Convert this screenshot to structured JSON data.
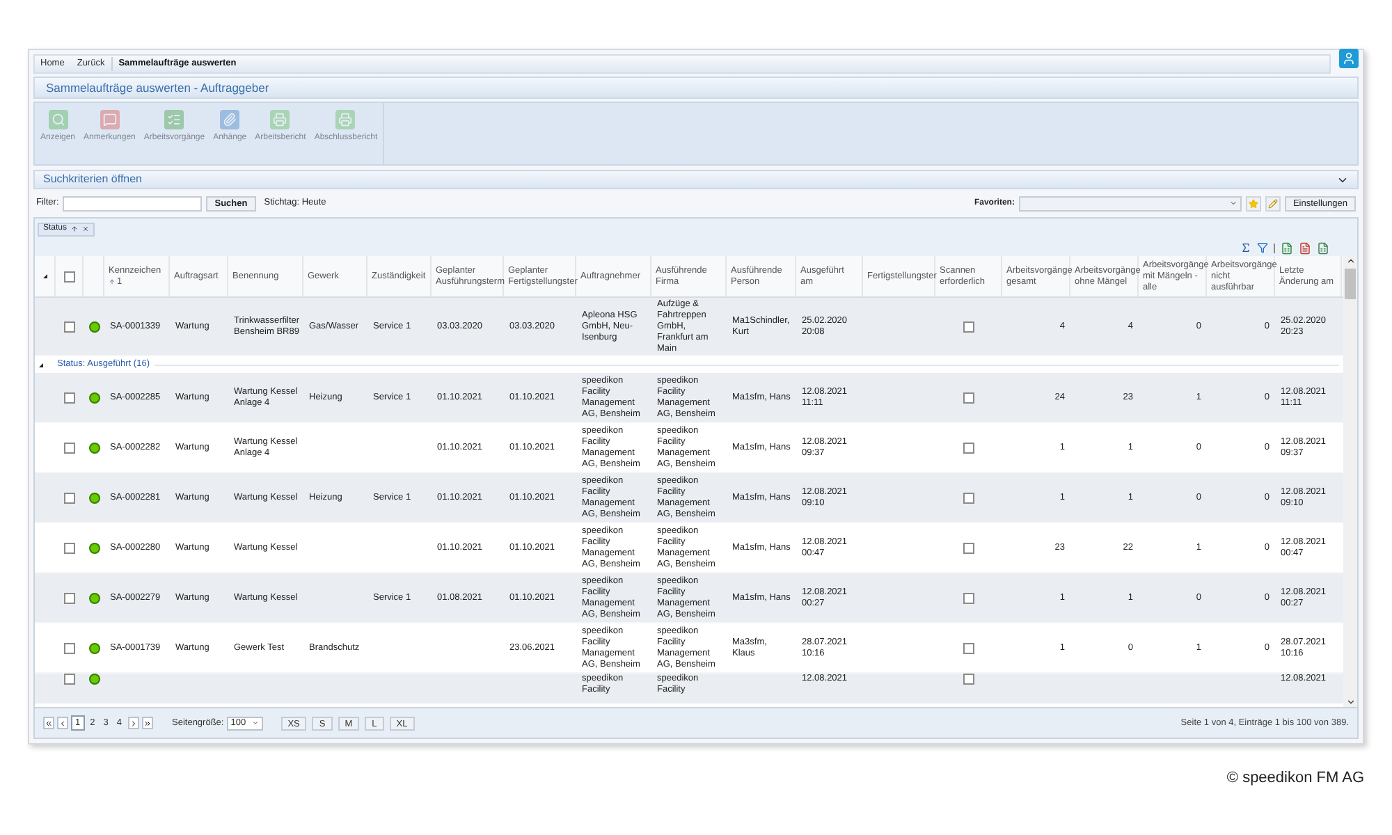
{
  "breadcrumb": [
    {
      "label": "Home",
      "current": false
    },
    {
      "label": "Zurück",
      "current": false
    },
    {
      "label": "Sammelaufträge auswerten",
      "current": true
    }
  ],
  "page_title": "Sammelaufträge auswerten - Auftraggeber",
  "toolbar": [
    {
      "label": "Anzeigen",
      "kind": "search",
      "disabled": true
    },
    {
      "label": "Anmerkungen",
      "kind": "notes",
      "disabled": true
    },
    {
      "label": "Arbeitsvorgänge",
      "kind": "tasks",
      "disabled": true
    },
    {
      "label": "Anhänge",
      "kind": "attachments",
      "disabled": true
    },
    {
      "label": "Arbeitsbericht",
      "kind": "print",
      "disabled": true
    },
    {
      "label": "Abschlussbericht",
      "kind": "print",
      "disabled": true
    }
  ],
  "search_panel": {
    "title": "Suchkriterien öffnen",
    "expanded": false
  },
  "filter": {
    "label": "Filter:",
    "button": "Suchen",
    "reference_date": "Stichtag: Heute",
    "favorites_label": "Favoriten:",
    "settings_button": "Einstellungen"
  },
  "grouping": [
    {
      "label": "Status"
    }
  ],
  "table": {
    "header_checked": false,
    "columns": [
      {
        "label": "Kennzeichen",
        "sort_order": "1",
        "kind": "text"
      },
      {
        "label": "Auftragsart",
        "kind": "text"
      },
      {
        "label": "Benennung",
        "kind": "text"
      },
      {
        "label": "Gewerk",
        "kind": "text"
      },
      {
        "label": "Zuständigkeit",
        "kind": "text"
      },
      {
        "label": "Geplanter Ausführungsterm",
        "kind": "text"
      },
      {
        "label": "Geplanter Fertigstellungster",
        "kind": "text"
      },
      {
        "label": "Auftragnehmer",
        "kind": "text"
      },
      {
        "label": "Ausführende Firma",
        "kind": "text"
      },
      {
        "label": "Ausführende Person",
        "kind": "text"
      },
      {
        "label": "Ausgeführt am",
        "kind": "text"
      },
      {
        "label": "Fertigstellungster",
        "kind": "text"
      },
      {
        "label": "Scannen erforderlich",
        "kind": "check"
      },
      {
        "label": "Arbeitsvorgänge gesamt",
        "kind": "number"
      },
      {
        "label": "Arbeitsvorgänge ohne Mängel",
        "kind": "number"
      },
      {
        "label": "Arbeitsvorgänge mit Mängeln - alle",
        "kind": "number"
      },
      {
        "label": "Arbeitsvorgänge nicht ausführbar",
        "kind": "number"
      },
      {
        "label": "Letzte Änderung am",
        "kind": "text"
      }
    ],
    "rows": [
      {
        "kind": "record",
        "checked": false,
        "color": "#66cc00",
        "cells": [
          "SA-0001339",
          "Wartung",
          "Trinkwasserfilter\nBensheim BR89",
          "Gas/Wasser",
          "Service 1",
          "03.03.2020",
          "03.03.2020",
          "Apleona HSG\nGmbH, Neu-\nIsenburg",
          "Aufzüge &\nFahrtreppen\nGmbH,\nFrankfurt am\nMain",
          "Ma1Schindler,\nKurt",
          "25.02.2020\n20:08",
          null,
          {
            "checked": false
          },
          "4",
          "4",
          "0",
          "0",
          "25.02.2020\n20:23"
        ]
      },
      {
        "kind": "group",
        "label": "Status: Ausgeführt (16)",
        "expanded": true
      },
      {
        "kind": "record",
        "checked": false,
        "color": "#66cc00",
        "cells": [
          "SA-0002285",
          "Wartung",
          "Wartung Kessel\nAnlage 4",
          "Heizung",
          "Service 1",
          "01.10.2021",
          "01.10.2021",
          "speedikon\nFacility\nManagement\nAG, Bensheim",
          "speedikon\nFacility\nManagement\nAG, Bensheim",
          "Ma1sfm, Hans",
          "12.08.2021\n11:11",
          null,
          {
            "checked": false
          },
          "24",
          "23",
          "1",
          "0",
          "12.08.2021\n11:11"
        ]
      },
      {
        "kind": "record",
        "checked": false,
        "color": "#66cc00",
        "cells": [
          "SA-0002282",
          "Wartung",
          "Wartung Kessel\nAnlage 4",
          null,
          null,
          "01.10.2021",
          "01.10.2021",
          "speedikon\nFacility\nManagement\nAG, Bensheim",
          "speedikon\nFacility\nManagement\nAG, Bensheim",
          "Ma1sfm, Hans",
          "12.08.2021\n09:37",
          null,
          {
            "checked": false
          },
          "1",
          "1",
          "0",
          "0",
          "12.08.2021\n09:37"
        ]
      },
      {
        "kind": "record",
        "checked": false,
        "color": "#66cc00",
        "cells": [
          "SA-0002281",
          "Wartung",
          "Wartung Kessel",
          "Heizung",
          "Service 1",
          "01.10.2021",
          "01.10.2021",
          "speedikon\nFacility\nManagement\nAG, Bensheim",
          "speedikon\nFacility\nManagement\nAG, Bensheim",
          "Ma1sfm, Hans",
          "12.08.2021\n09:10",
          null,
          {
            "checked": false
          },
          "1",
          "1",
          "0",
          "0",
          "12.08.2021\n09:10"
        ]
      },
      {
        "kind": "record",
        "checked": false,
        "color": "#66cc00",
        "cells": [
          "SA-0002280",
          "Wartung",
          "Wartung Kessel",
          null,
          null,
          "01.10.2021",
          "01.10.2021",
          "speedikon\nFacility\nManagement\nAG, Bensheim",
          "speedikon\nFacility\nManagement\nAG, Bensheim",
          "Ma1sfm, Hans",
          "12.08.2021\n00:47",
          null,
          {
            "checked": false
          },
          "23",
          "22",
          "1",
          "0",
          "12.08.2021\n00:47"
        ]
      },
      {
        "kind": "record",
        "checked": false,
        "color": "#66cc00",
        "cells": [
          "SA-0002279",
          "Wartung",
          "Wartung Kessel",
          null,
          "Service 1",
          "01.08.2021",
          "01.10.2021",
          "speedikon\nFacility\nManagement\nAG, Bensheim",
          "speedikon\nFacility\nManagement\nAG, Bensheim",
          "Ma1sfm, Hans",
          "12.08.2021\n00:27",
          null,
          {
            "checked": false
          },
          "1",
          "1",
          "0",
          "0",
          "12.08.2021\n00:27"
        ]
      },
      {
        "kind": "record",
        "checked": false,
        "color": "#66cc00",
        "cells": [
          "SA-0001739",
          "Wartung",
          "Gewerk Test",
          "Brandschutz",
          null,
          null,
          "23.06.2021",
          "speedikon\nFacility\nManagement\nAG, Bensheim",
          "speedikon\nFacility\nManagement\nAG, Bensheim",
          "Ma3sfm, Klaus",
          "28.07.2021\n10:16",
          null,
          {
            "checked": false
          },
          "1",
          "0",
          "1",
          "0",
          "28.07.2021\n10:16"
        ]
      },
      {
        "kind": "partial",
        "checked": false,
        "color": "#66cc00",
        "cells": [
          null,
          null,
          null,
          null,
          null,
          null,
          null,
          "speedikon\nFacility",
          "speedikon\nFacility",
          null,
          "12.08.2021",
          null,
          {
            "checked": false
          },
          null,
          null,
          null,
          null,
          "12.08.2021"
        ]
      }
    ]
  },
  "pager": {
    "pages": [
      {
        "label": "1",
        "selected": true
      },
      {
        "label": "2",
        "selected": false
      },
      {
        "label": "3",
        "selected": false
      },
      {
        "label": "4",
        "selected": false
      }
    ],
    "page_size_label": "Seitengröße:",
    "page_size": "100",
    "sizes": [
      "XS",
      "S",
      "M",
      "L",
      "XL"
    ],
    "summary": "Seite 1 von 4, Einträge 1 bis 100 von 389."
  },
  "caption": "© speedikon FM AG"
}
